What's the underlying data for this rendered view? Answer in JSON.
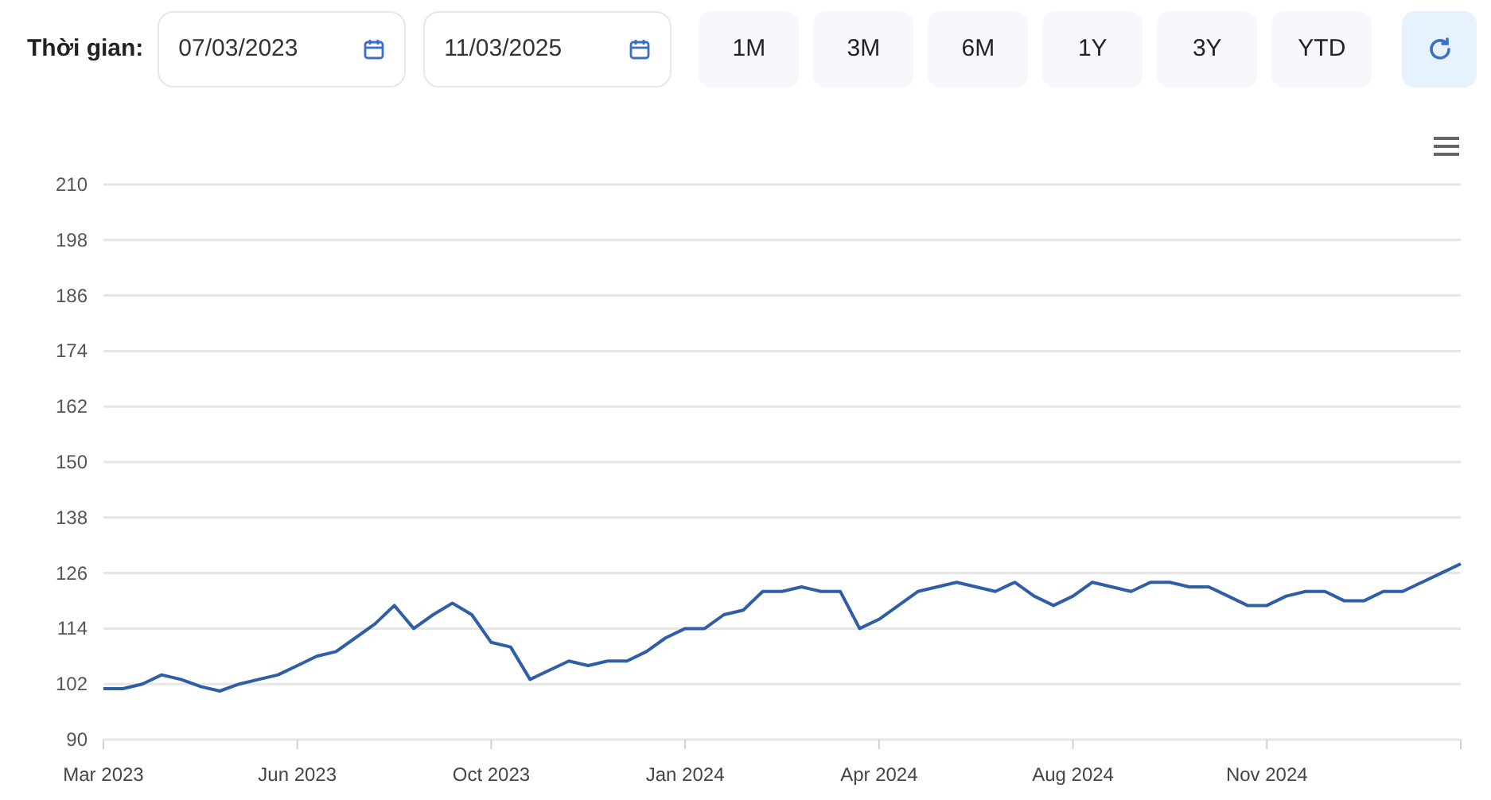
{
  "filter": {
    "label": "Thời gian:",
    "from_date": "07/03/2023",
    "to_date": "11/03/2025",
    "ranges": [
      {
        "label": "1M",
        "selected": false
      },
      {
        "label": "3M",
        "selected": false
      },
      {
        "label": "6M",
        "selected": false
      },
      {
        "label": "1Y",
        "selected": false
      },
      {
        "label": "3Y",
        "selected": false
      },
      {
        "label": "YTD",
        "selected": false
      }
    ]
  },
  "chart": {
    "chart_data": {
      "type": "line",
      "categories": [
        "Mar 2023",
        null,
        null,
        null,
        null,
        null,
        null,
        null,
        null,
        null,
        "Jun 2023",
        null,
        null,
        null,
        null,
        null,
        null,
        null,
        null,
        null,
        "Oct 2023",
        null,
        null,
        null,
        null,
        null,
        null,
        null,
        null,
        null,
        "Jan 2024",
        null,
        null,
        null,
        null,
        null,
        null,
        null,
        null,
        null,
        "Apr 2024",
        null,
        null,
        null,
        null,
        null,
        null,
        null,
        null,
        null,
        "Aug 2024",
        null,
        null,
        null,
        null,
        null,
        null,
        null,
        null,
        null,
        "Nov 2024",
        null,
        null,
        null,
        null,
        null,
        null,
        null,
        null,
        null,
        null
      ],
      "series": [
        {
          "color": "#2f5ea8",
          "values": [
            101,
            101,
            102,
            104,
            103,
            101.5,
            100.5,
            102,
            103,
            104,
            106,
            108,
            109,
            112,
            115,
            119,
            114,
            117,
            119.5,
            117,
            111,
            110,
            103,
            105,
            107,
            106,
            107,
            107,
            109,
            112,
            114,
            114,
            117,
            118,
            122,
            122,
            123,
            122,
            122,
            114,
            116,
            119,
            122,
            123,
            124,
            123,
            122,
            124,
            121,
            119,
            121,
            124,
            123,
            122,
            124,
            124,
            123,
            123,
            121,
            119,
            119,
            121,
            122,
            122,
            120,
            120,
            122,
            122,
            124,
            126,
            128
          ]
        }
      ],
      "ylim": [
        90,
        210
      ],
      "grid": true,
      "yticks": [
        90,
        102,
        114,
        126,
        138,
        150,
        162,
        174,
        186,
        198,
        210
      ]
    }
  }
}
